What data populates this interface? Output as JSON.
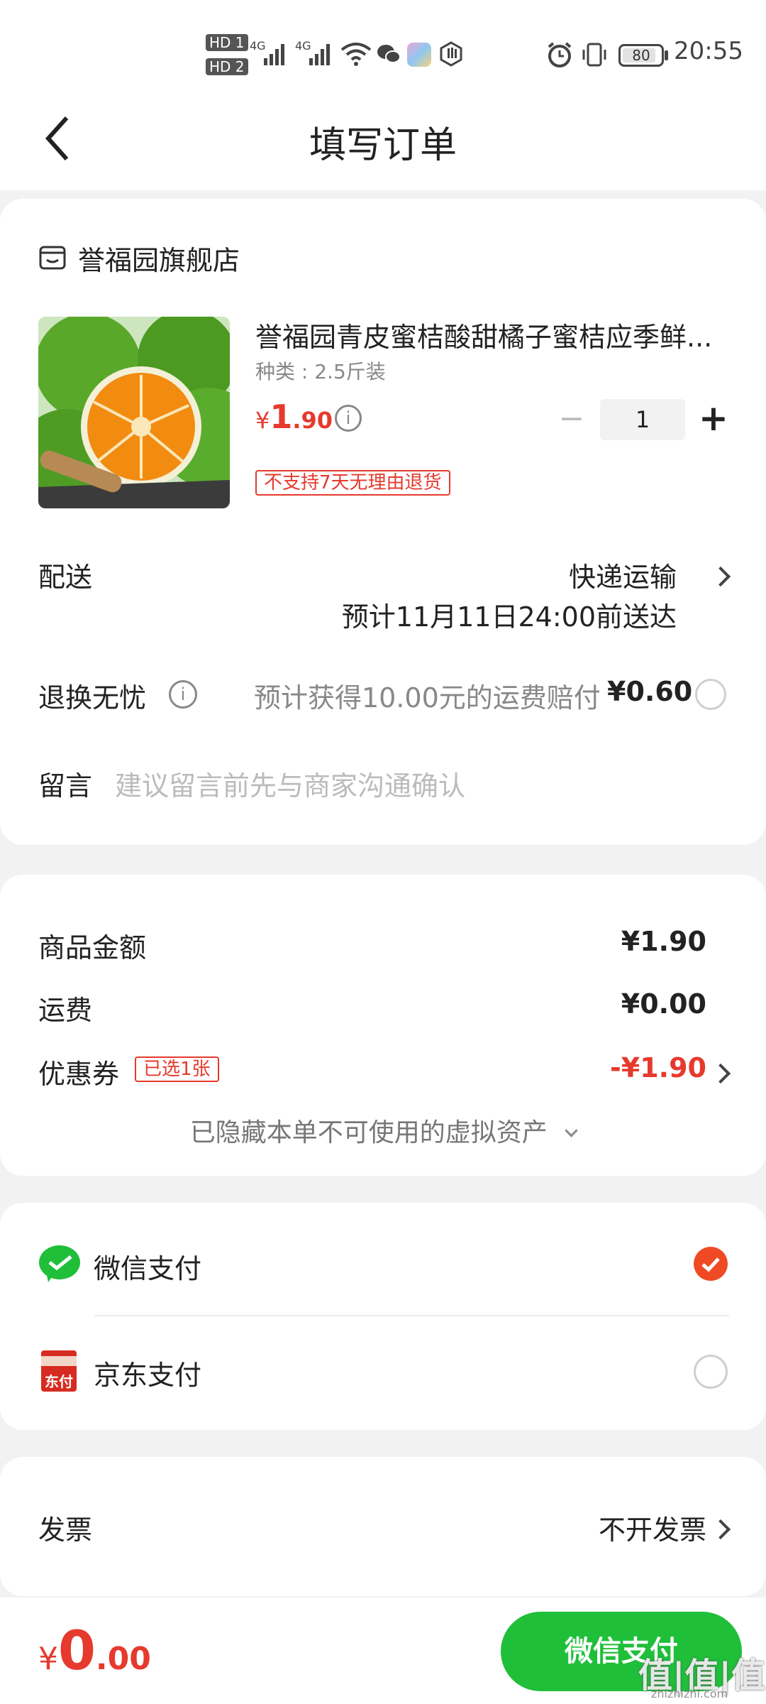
{
  "status_bar": {
    "signal_labels": [
      "HD 1",
      "HD 2",
      "4G",
      "4G"
    ],
    "battery": "80",
    "time": "20:55"
  },
  "header": {
    "title": "填写订单"
  },
  "store": {
    "name": "誉福园旗舰店"
  },
  "product": {
    "title": "誉福园青皮蜜桔酸甜橘子蜜桔应季鲜...",
    "spec": "种类 : 2.5斤装",
    "price_symbol": "¥",
    "price_int": "1",
    "price_dec": ".90",
    "quantity": "1",
    "minus": "−",
    "plus": "+",
    "return_tag": "不支持7天无理由退货"
  },
  "delivery": {
    "label": "配送",
    "method": "快递运输",
    "eta": "预计11月11日24:00前送达"
  },
  "return_insurance": {
    "label": "退换无忧",
    "desc": "预计获得10.00元的运费赔付",
    "price": "¥0.60"
  },
  "message": {
    "label": "留言",
    "placeholder": "建议留言前先与商家沟通确认"
  },
  "amounts": {
    "goods_label": "商品金额",
    "goods_value": "¥1.90",
    "shipping_label": "运费",
    "shipping_value": "¥0.00",
    "coupon_label": "优惠券",
    "coupon_tag": "已选1张",
    "coupon_value": "-¥1.90",
    "hidden_assets": "已隐藏本单不可使用的虚拟资产"
  },
  "payment": {
    "wechat_label": "微信支付",
    "jd_label": "京东支付",
    "jd_icon_text": "东付",
    "wechat_selected": true
  },
  "invoice": {
    "label": "发票",
    "value": "不开发票"
  },
  "footer": {
    "total_symbol": "¥",
    "total_int": "0",
    "total_dec": ".00",
    "pay_button": "微信支付",
    "watermark": "值|值|值",
    "watermark_url": "zhizhizhi.com"
  },
  "colors": {
    "accent_red": "#e53a2d",
    "wechat_green": "#1fbf3a",
    "selected_orange": "#f04a24"
  }
}
